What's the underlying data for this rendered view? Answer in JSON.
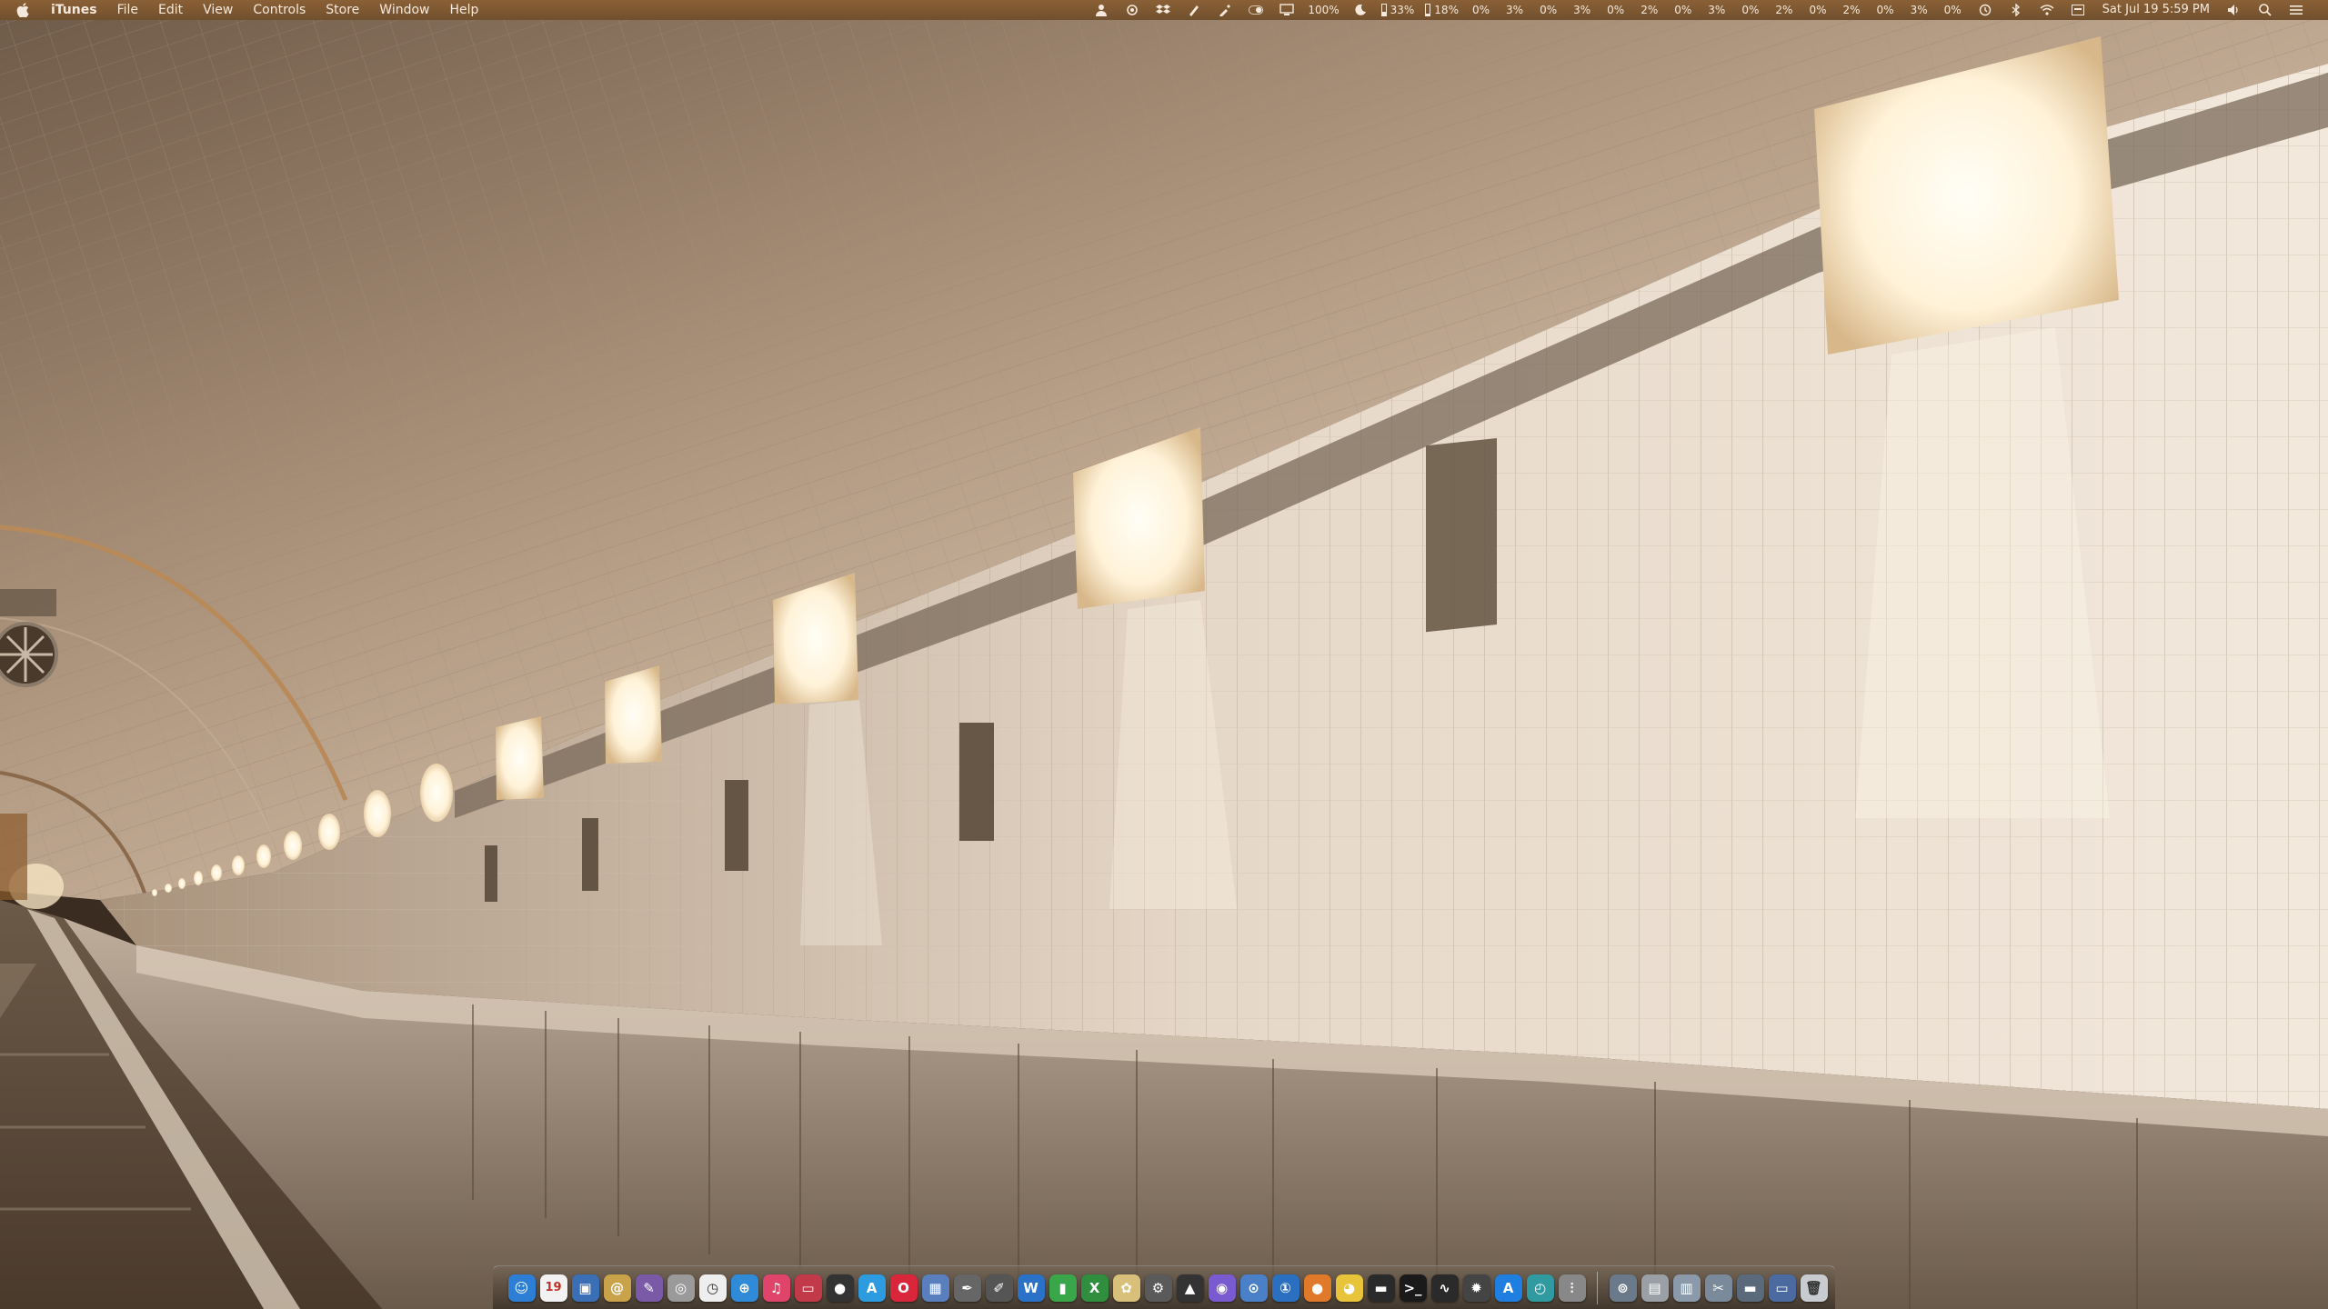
{
  "menubar": {
    "app_name": "iTunes",
    "menus": [
      "File",
      "Edit",
      "View",
      "Controls",
      "Store",
      "Window",
      "Help"
    ],
    "zoom": "100%",
    "battery_meter": "33%",
    "memory_meter": "18%",
    "cpu_values": [
      "0%",
      "3%",
      "0%",
      "3%",
      "0%",
      "2%",
      "0%",
      "3%",
      "0%",
      "2%",
      "0%",
      "2%",
      "0%",
      "3%",
      "0%"
    ],
    "clock": "Sat Jul 19  5:59 PM"
  },
  "dock": {
    "calendar_day": "19",
    "apps": [
      {
        "name": "finder-icon",
        "color": "#2d7fd6",
        "glyph": "☺"
      },
      {
        "name": "calendar-icon",
        "color": "#f2f2f2",
        "glyph": ""
      },
      {
        "name": "preview-icon",
        "color": "#3b6fb5",
        "glyph": "▣"
      },
      {
        "name": "mail-icon",
        "color": "#c9a24a",
        "glyph": "@"
      },
      {
        "name": "photo-app-icon",
        "color": "#7a5aa6",
        "glyph": "✎"
      },
      {
        "name": "disk-utility-icon",
        "color": "#9a9a9a",
        "glyph": "◎"
      },
      {
        "name": "clock-icon",
        "color": "#eeeeee",
        "glyph": "◷"
      },
      {
        "name": "safari-icon",
        "color": "#2f8bd8",
        "glyph": "⊕"
      },
      {
        "name": "itunes-icon",
        "color": "#e0446a",
        "glyph": "♫"
      },
      {
        "name": "photo-booth-icon",
        "color": "#c23a4a",
        "glyph": "▭"
      },
      {
        "name": "camera-icon",
        "color": "#333333",
        "glyph": "●"
      },
      {
        "name": "app-store-icon",
        "color": "#2c9be0",
        "glyph": "A"
      },
      {
        "name": "opera-icon",
        "color": "#d9263b",
        "glyph": "O"
      },
      {
        "name": "image-capture-icon",
        "color": "#5a7fbf",
        "glyph": "▦"
      },
      {
        "name": "pen-tablet-icon",
        "color": "#666666",
        "glyph": "✒"
      },
      {
        "name": "pen-icon",
        "color": "#555555",
        "glyph": "✐"
      },
      {
        "name": "word-icon",
        "color": "#2a72c8",
        "glyph": "W"
      },
      {
        "name": "numbers-icon",
        "color": "#3aa64a",
        "glyph": "▮"
      },
      {
        "name": "excel-icon",
        "color": "#2f8f3e",
        "glyph": "X"
      },
      {
        "name": "gift-icon",
        "color": "#d8c07a",
        "glyph": "✿"
      },
      {
        "name": "settings-icon",
        "color": "#5a5a5a",
        "glyph": "⚙"
      },
      {
        "name": "vlc-icon",
        "color": "#333333",
        "glyph": "▲"
      },
      {
        "name": "video-icon",
        "color": "#7a5ad0",
        "glyph": "◉"
      },
      {
        "name": "system-info-icon",
        "color": "#4a80c8",
        "glyph": "⊙"
      },
      {
        "name": "1password-icon",
        "color": "#2a6fc0",
        "glyph": "①"
      },
      {
        "name": "fruit-icon",
        "color": "#e07a2a",
        "glyph": "●"
      },
      {
        "name": "chrome-icon",
        "color": "#e8c43a",
        "glyph": "◕"
      },
      {
        "name": "terminal-dark-icon",
        "color": "#2a2a2a",
        "glyph": "▬"
      },
      {
        "name": "terminal-icon",
        "color": "#1a1a1a",
        "glyph": ">_"
      },
      {
        "name": "activity-monitor-icon",
        "color": "#2a2a2a",
        "glyph": "∿"
      },
      {
        "name": "network-icon",
        "color": "#444444",
        "glyph": "✹"
      },
      {
        "name": "app-store-blue-icon",
        "color": "#1f7fe0",
        "glyph": "A"
      },
      {
        "name": "time-machine-icon",
        "color": "#2f9aa0",
        "glyph": "◴"
      },
      {
        "name": "audio-icon",
        "color": "#888888",
        "glyph": "⫶"
      }
    ],
    "utilities": [
      {
        "name": "downloads-stack-icon",
        "color": "#6a7a8a",
        "glyph": "⊚"
      },
      {
        "name": "printer-icon",
        "color": "#9aa0a6",
        "glyph": "▤"
      },
      {
        "name": "folder-stack-icon",
        "color": "#8a9aaa",
        "glyph": "▥"
      },
      {
        "name": "applications-stack-icon",
        "color": "#7a8a9a",
        "glyph": "✂"
      },
      {
        "name": "documents-stack-icon",
        "color": "#5a6a7a",
        "glyph": "▬"
      },
      {
        "name": "desktop-stack-icon",
        "color": "#4a6aa0",
        "glyph": "▭"
      },
      {
        "name": "trash-icon",
        "color": "#c8ccd0",
        "glyph": "🗑"
      }
    ]
  }
}
